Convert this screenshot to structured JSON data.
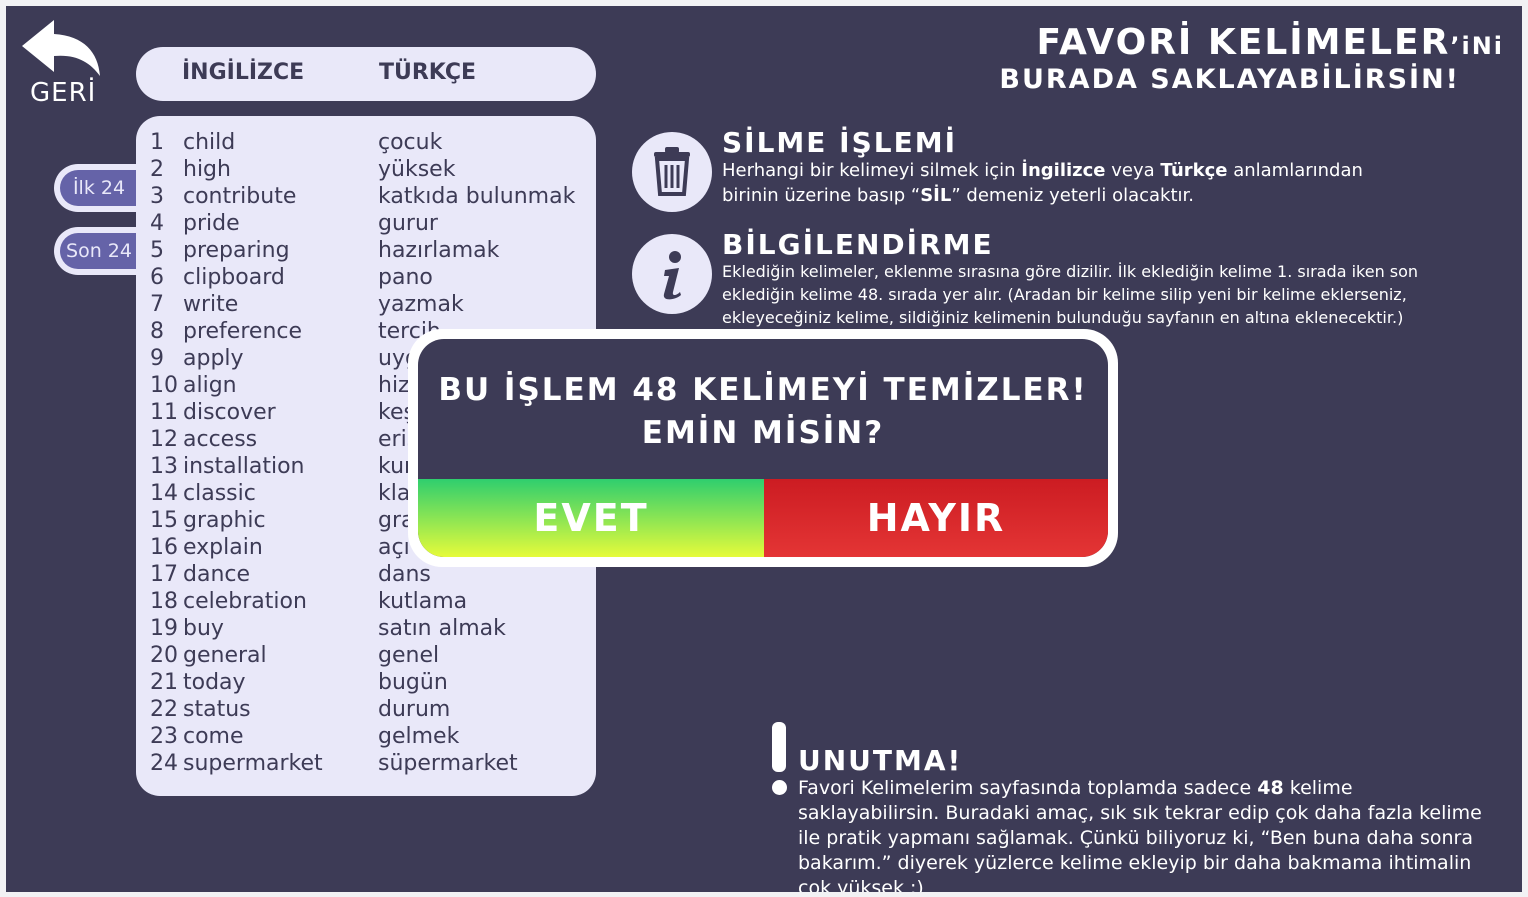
{
  "back": {
    "label": "GERİ"
  },
  "list_header": {
    "english": "İNGİLİZCE",
    "turkish": "TÜRKÇE"
  },
  "tabs": {
    "first": "İlk 24",
    "last": "Son 24"
  },
  "words": [
    {
      "n": "1",
      "en": "child",
      "tr": "çocuk"
    },
    {
      "n": "2",
      "en": "high",
      "tr": "yüksek"
    },
    {
      "n": "3",
      "en": "contribute",
      "tr": "katkıda bulunmak"
    },
    {
      "n": "4",
      "en": "pride",
      "tr": "gurur"
    },
    {
      "n": "5",
      "en": "preparing",
      "tr": "hazırlamak"
    },
    {
      "n": "6",
      "en": "clipboard",
      "tr": "pano"
    },
    {
      "n": "7",
      "en": "write",
      "tr": "yazmak"
    },
    {
      "n": "8",
      "en": "preference",
      "tr": "tercih"
    },
    {
      "n": "9",
      "en": "apply",
      "tr": "uyg"
    },
    {
      "n": "10",
      "en": "align",
      "tr": "hiz"
    },
    {
      "n": "11",
      "en": "discover",
      "tr": "keş"
    },
    {
      "n": "12",
      "en": "access",
      "tr": "eriş"
    },
    {
      "n": "13",
      "en": "installation",
      "tr": "kur"
    },
    {
      "n": "14",
      "en": "classic",
      "tr": "kla"
    },
    {
      "n": "15",
      "en": "graphic",
      "tr": "gra"
    },
    {
      "n": "16",
      "en": "explain",
      "tr": "açı"
    },
    {
      "n": "17",
      "en": "dance",
      "tr": "dans"
    },
    {
      "n": "18",
      "en": "celebration",
      "tr": "kutlama"
    },
    {
      "n": "19",
      "en": "buy",
      "tr": "satın almak"
    },
    {
      "n": "20",
      "en": "general",
      "tr": "genel"
    },
    {
      "n": "21",
      "en": "today",
      "tr": "bugün"
    },
    {
      "n": "22",
      "en": "status",
      "tr": "durum"
    },
    {
      "n": "23",
      "en": "come",
      "tr": "gelmek"
    },
    {
      "n": "24",
      "en": "supermarket",
      "tr": "süpermarket"
    }
  ],
  "title": {
    "line1": "FAVORİ KELİMELER",
    "suffix": "’iNi",
    "line2": "BURADA SAKLAYABİLİRSİN!"
  },
  "delete_section": {
    "heading": "SİLME İŞLEMİ",
    "text_1": "Herhangi bir kelimeyi silmek için ",
    "bold_1": "İngilizce",
    "text_2": " veya ",
    "bold_2": "Türkçe",
    "text_3": " anlamlarından birinin üzerine basıp “",
    "bold_3": "SİL",
    "text_4": "” demeniz yeterli olacaktır."
  },
  "info_section": {
    "heading": "BİLGİLENDİRME",
    "text": "Eklediğin kelimeler, eklenme sırasına göre dizilir. İlk eklediğin kelime 1. sırada iken son eklediğin kelime 48. sırada yer alır. (Aradan bir kelime silip yeni bir kelime eklerseniz, ekleyeceğiniz kelime, sildiğiniz kelimenin bulunduğu sayfanın en altına eklenecektir.)"
  },
  "reminder": {
    "heading": "UNUTMA!",
    "text_1": "Favori Kelimelerim sayfasında toplamda sadece ",
    "count": "48",
    "text_2": " kelime saklayabilirsin. Buradaki amaç, sık sık tekrar edip çok daha fazla kelime ile pratik yapmanı sağlamak. Çünkü biliyoruz ki, “Ben buna daha sonra bakarım.” diyerek yüzlerce kelime ekleyip bir daha bakmama ihtimalin çok yüksek :)"
  },
  "modal": {
    "question_line1": "BU İŞLEM 48 KELİMEYİ TEMİZLER!",
    "question_line2": "EMİN MİSİN?",
    "yes": "EVET",
    "no": "HAYIR"
  },
  "colors": {
    "background": "#3d3b56",
    "panel": "#e9e8f9",
    "tab_accent": "#6563a8",
    "yes_top": "#2fce6e",
    "yes_bottom": "#e6fb3a",
    "no": "#d32026"
  }
}
